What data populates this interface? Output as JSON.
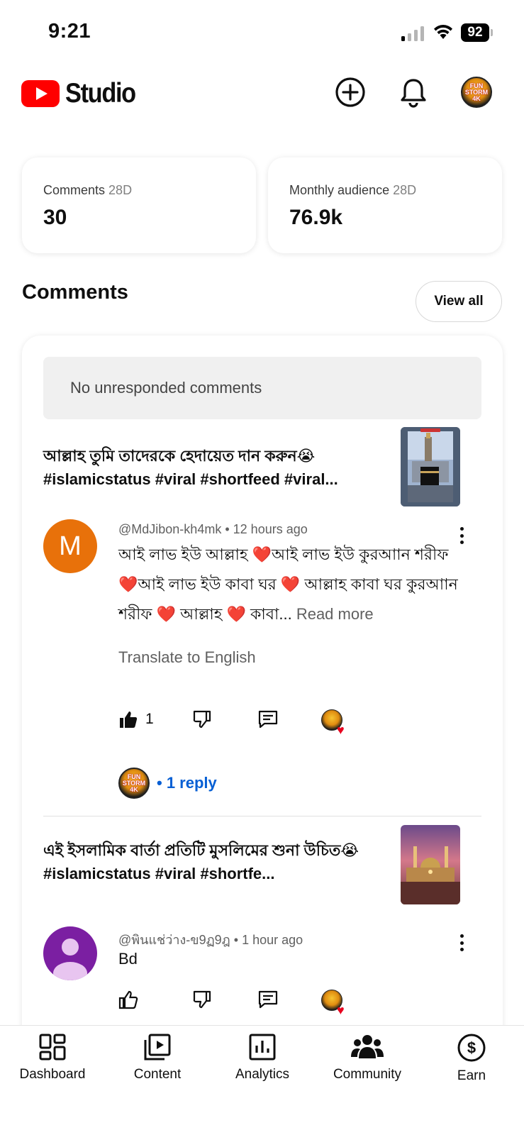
{
  "status_bar": {
    "time": "9:21",
    "battery": "92"
  },
  "header": {
    "logo_text": "Studio"
  },
  "stats": [
    {
      "label": "Comments",
      "period": "28D",
      "value": "30"
    },
    {
      "label": "Monthly audience",
      "period": "28D",
      "value": "76.9k"
    }
  ],
  "comments_section": {
    "title": "Comments",
    "view_all_label": "View all",
    "banner": "No unresponded comments",
    "items": [
      {
        "video_title": "আল্লাহ তুমি তাদেরকে হেদায়েত দান করুন😭 #islamicstatus #viral #shortfeed #viral...",
        "author": "@MdJibon-kh4mk",
        "time": "12 hours ago",
        "avatar_letter": "M",
        "text": "আই লাভ ইউ আল্লাহ ❤️আই লাভ ইউ কুরআান শরীফ ❤️আই লাভ ইউ কাবা ঘর ❤️ আল্লাহ কাবা ঘর কুরআান শরীফ ❤️ আল্লাহ ❤️ কাবা... ",
        "read_more": "Read more",
        "translate": "Translate to English",
        "likes": "1",
        "reply_link": "• 1 reply"
      },
      {
        "video_title": "এই ইসলামিক বার্তা প্রতিটি মুসলিমের শুনা উচিত😭 #islamicstatus #viral #shortfe...",
        "author": "@พินแช่ว่าง-ข9ฏ9ฎ",
        "time": "1 hour ago",
        "text": "Bd"
      }
    ]
  },
  "bottom_nav": [
    {
      "label": "Dashboard",
      "icon": "dashboard-icon"
    },
    {
      "label": "Content",
      "icon": "content-icon"
    },
    {
      "label": "Analytics",
      "icon": "analytics-icon"
    },
    {
      "label": "Community",
      "icon": "community-icon"
    },
    {
      "label": "Earn",
      "icon": "earn-icon"
    }
  ],
  "colors": {
    "youtube_red": "#ff0000",
    "link_blue": "#065fd4",
    "avatar_orange": "#e8710a",
    "avatar_purple": "#7b1fa2",
    "heart": "#e8001e"
  },
  "avatar_badge_text": "FUN STORM 4K"
}
